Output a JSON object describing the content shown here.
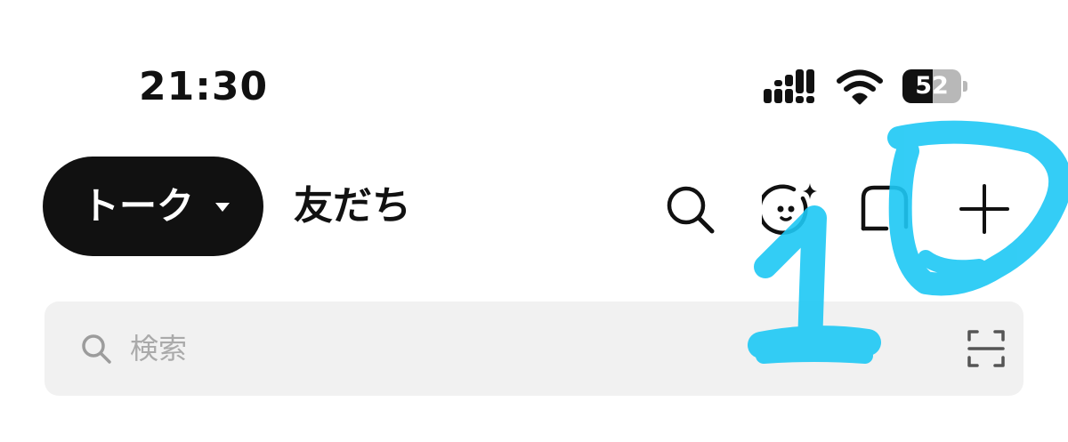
{
  "status_bar": {
    "time": "21:30",
    "battery_level": "52",
    "battery_fraction": 0.52
  },
  "header": {
    "tabs": [
      {
        "label": "トーク",
        "active": true
      },
      {
        "label": "友だち",
        "active": false
      }
    ],
    "actions": [
      "search-icon",
      "ai-sparkle-face-icon",
      "chat-bubble-icon",
      "add-icon"
    ]
  },
  "search": {
    "placeholder": "検索",
    "value": ""
  },
  "annotation": {
    "label": "1",
    "color": "#1ec8f5"
  }
}
